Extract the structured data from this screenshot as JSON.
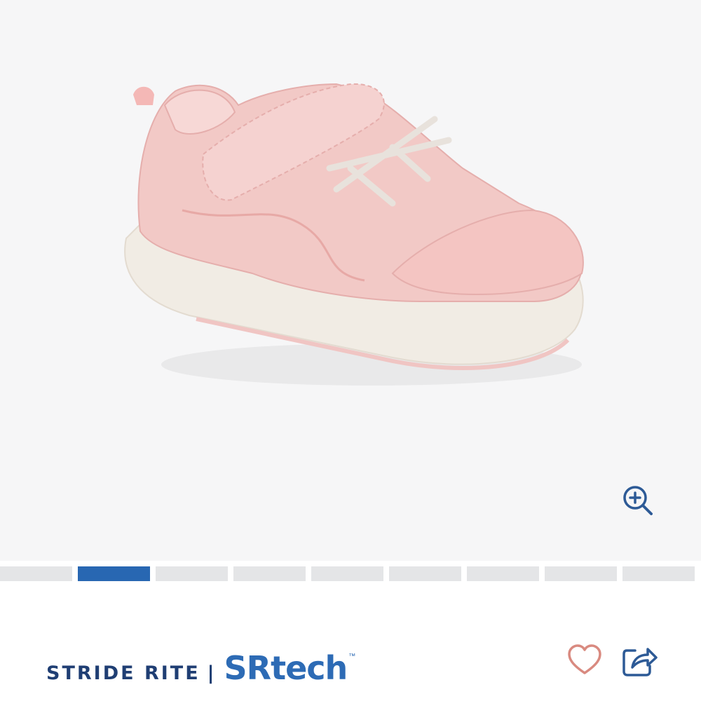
{
  "product": {
    "image_alt": "pink toddler sneaker with velcro strap and elastic laces",
    "colors": {
      "upper": "#f2c9c6",
      "sole": "#f1ece4",
      "accent_blue": "#2867b2",
      "brand_dark": "#1f3e73",
      "heart": "#d98a80"
    }
  },
  "gallery": {
    "zoom_icon": "zoom-in-icon",
    "total_images": 9,
    "active_index": 1
  },
  "brand": {
    "name": "STRIDE RITE",
    "separator": "|",
    "sub": "SRtech",
    "tm": "™"
  },
  "actions": {
    "favorite_icon": "heart-icon",
    "share_icon": "share-icon"
  }
}
